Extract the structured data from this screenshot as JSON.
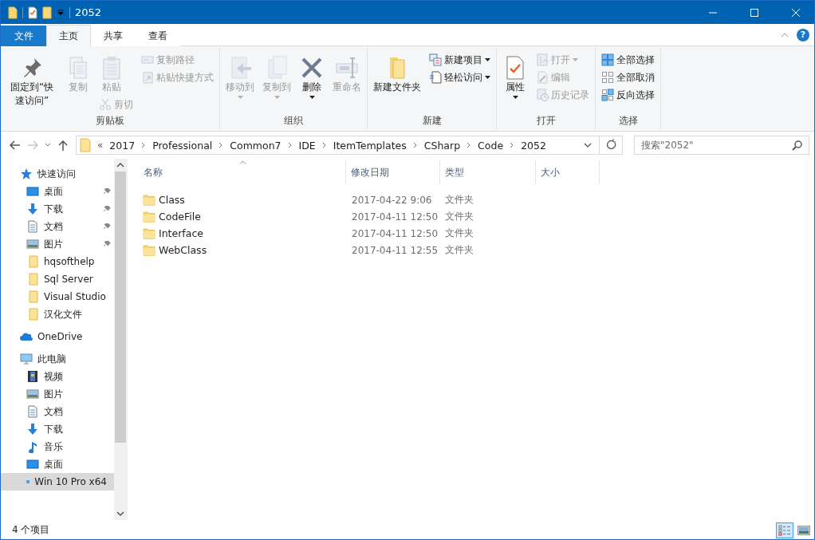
{
  "window": {
    "title": "2052"
  },
  "ribbon_tabs": [
    {
      "label": "文件",
      "kind": "file",
      "selected": false
    },
    {
      "label": "主页",
      "kind": "tab",
      "selected": true
    },
    {
      "label": "共享",
      "kind": "tab",
      "selected": false
    },
    {
      "label": "查看",
      "kind": "tab",
      "selected": false
    }
  ],
  "help": {
    "glyph": "?"
  },
  "ribbon": {
    "groups": [
      {
        "label": "剪贴板",
        "columns": [
          [
            {
              "label": "固定到“快速访问”",
              "kind": "large",
              "disabled": false,
              "dropdown": false
            }
          ],
          [
            {
              "label": "复制",
              "kind": "large",
              "disabled": true,
              "dropdown": false
            }
          ],
          [
            {
              "label": "粘贴",
              "kind": "large",
              "disabled": true,
              "dropdown": false
            },
            {
              "label": "剪切",
              "kind": "small",
              "disabled": true,
              "dropdown": false
            }
          ],
          [
            {
              "label": "复制路径",
              "kind": "small",
              "disabled": true,
              "dropdown": false
            },
            {
              "label": "粘贴快捷方式",
              "kind": "small",
              "disabled": true,
              "dropdown": false
            }
          ]
        ]
      },
      {
        "label": "组织",
        "columns": [
          [
            {
              "label": "移动到",
              "kind": "large",
              "disabled": true,
              "dropdown": true
            }
          ],
          [
            {
              "label": "复制到",
              "kind": "large",
              "disabled": true,
              "dropdown": true
            }
          ],
          [
            {
              "label": "删除",
              "kind": "large",
              "disabled": false,
              "dropdown": true
            }
          ],
          [
            {
              "label": "重命名",
              "kind": "large",
              "disabled": true,
              "dropdown": false
            }
          ]
        ]
      },
      {
        "label": "新建",
        "columns": [
          [
            {
              "label": "新建文件夹",
              "kind": "large",
              "disabled": false,
              "dropdown": false
            }
          ],
          [
            {
              "label": "新建项目",
              "kind": "small",
              "disabled": false,
              "dropdown": true
            },
            {
              "label": "轻松访问",
              "kind": "small",
              "disabled": false,
              "dropdown": true
            }
          ]
        ]
      },
      {
        "label": "打开",
        "columns": [
          [
            {
              "label": "属性",
              "kind": "large",
              "disabled": false,
              "dropdown": true
            }
          ],
          [
            {
              "label": "打开",
              "kind": "small",
              "disabled": true,
              "dropdown": true
            },
            {
              "label": "编辑",
              "kind": "small",
              "disabled": true,
              "dropdown": false
            },
            {
              "label": "历史记录",
              "kind": "small",
              "disabled": true,
              "dropdown": false
            }
          ]
        ]
      },
      {
        "label": "选择",
        "columns": [
          [
            {
              "label": "全部选择",
              "kind": "small",
              "disabled": false,
              "dropdown": false
            },
            {
              "label": "全部取消",
              "kind": "small",
              "disabled": false,
              "dropdown": false
            },
            {
              "label": "反向选择",
              "kind": "small",
              "disabled": false,
              "dropdown": false
            }
          ]
        ]
      }
    ]
  },
  "navigation": {
    "back_disabled": false,
    "forward_disabled": true
  },
  "address": {
    "overflow_mark": "«",
    "crumbs": [
      "2017",
      "Professional",
      "Common7",
      "IDE",
      "ItemTemplates",
      "CSharp",
      "Code",
      "2052"
    ]
  },
  "search": {
    "placeholder": "搜索\"2052\""
  },
  "sidebar": {
    "items": [
      {
        "label": "快速访问",
        "selected": false,
        "children": [
          {
            "label": "桌面",
            "pinned": true,
            "selected": false
          },
          {
            "label": "下载",
            "pinned": true,
            "selected": false
          },
          {
            "label": "文档",
            "pinned": true,
            "selected": false
          },
          {
            "label": "图片",
            "pinned": true,
            "selected": false
          },
          {
            "label": "hqsofthelp",
            "pinned": false,
            "selected": false
          },
          {
            "label": "Sql Server",
            "pinned": false,
            "selected": false
          },
          {
            "label": "Visual Studio",
            "pinned": false,
            "selected": false
          },
          {
            "label": "汉化文件",
            "pinned": false,
            "selected": false
          }
        ]
      },
      {
        "label": "OneDrive",
        "selected": false
      },
      {
        "label": "此电脑",
        "selected": false,
        "children": [
          {
            "label": "视频",
            "selected": false
          },
          {
            "label": "图片",
            "selected": false
          },
          {
            "label": "文档",
            "selected": false
          },
          {
            "label": "下载",
            "selected": false
          },
          {
            "label": "音乐",
            "selected": false
          },
          {
            "label": "桌面",
            "selected": false
          },
          {
            "label": "Win 10 Pro x64",
            "selected": true
          }
        ]
      }
    ]
  },
  "table": {
    "columns": [
      {
        "label": "名称",
        "sorted": true
      },
      {
        "label": "修改日期",
        "sorted": false
      },
      {
        "label": "类型",
        "sorted": false
      },
      {
        "label": "大小",
        "sorted": false
      }
    ],
    "rows": [
      {
        "name": "Class",
        "modified": "2017-04-22 9:06",
        "type": "文件夹"
      },
      {
        "name": "CodeFile",
        "modified": "2017-04-11 12:50",
        "type": "文件夹"
      },
      {
        "name": "Interface",
        "modified": "2017-04-11 12:50",
        "type": "文件夹"
      },
      {
        "name": "WebClass",
        "modified": "2017-04-11 12:55",
        "type": "文件夹"
      }
    ]
  },
  "status_bar": {
    "count": "4 个项目",
    "views": [
      {
        "selected": true
      },
      {
        "selected": false
      }
    ]
  }
}
